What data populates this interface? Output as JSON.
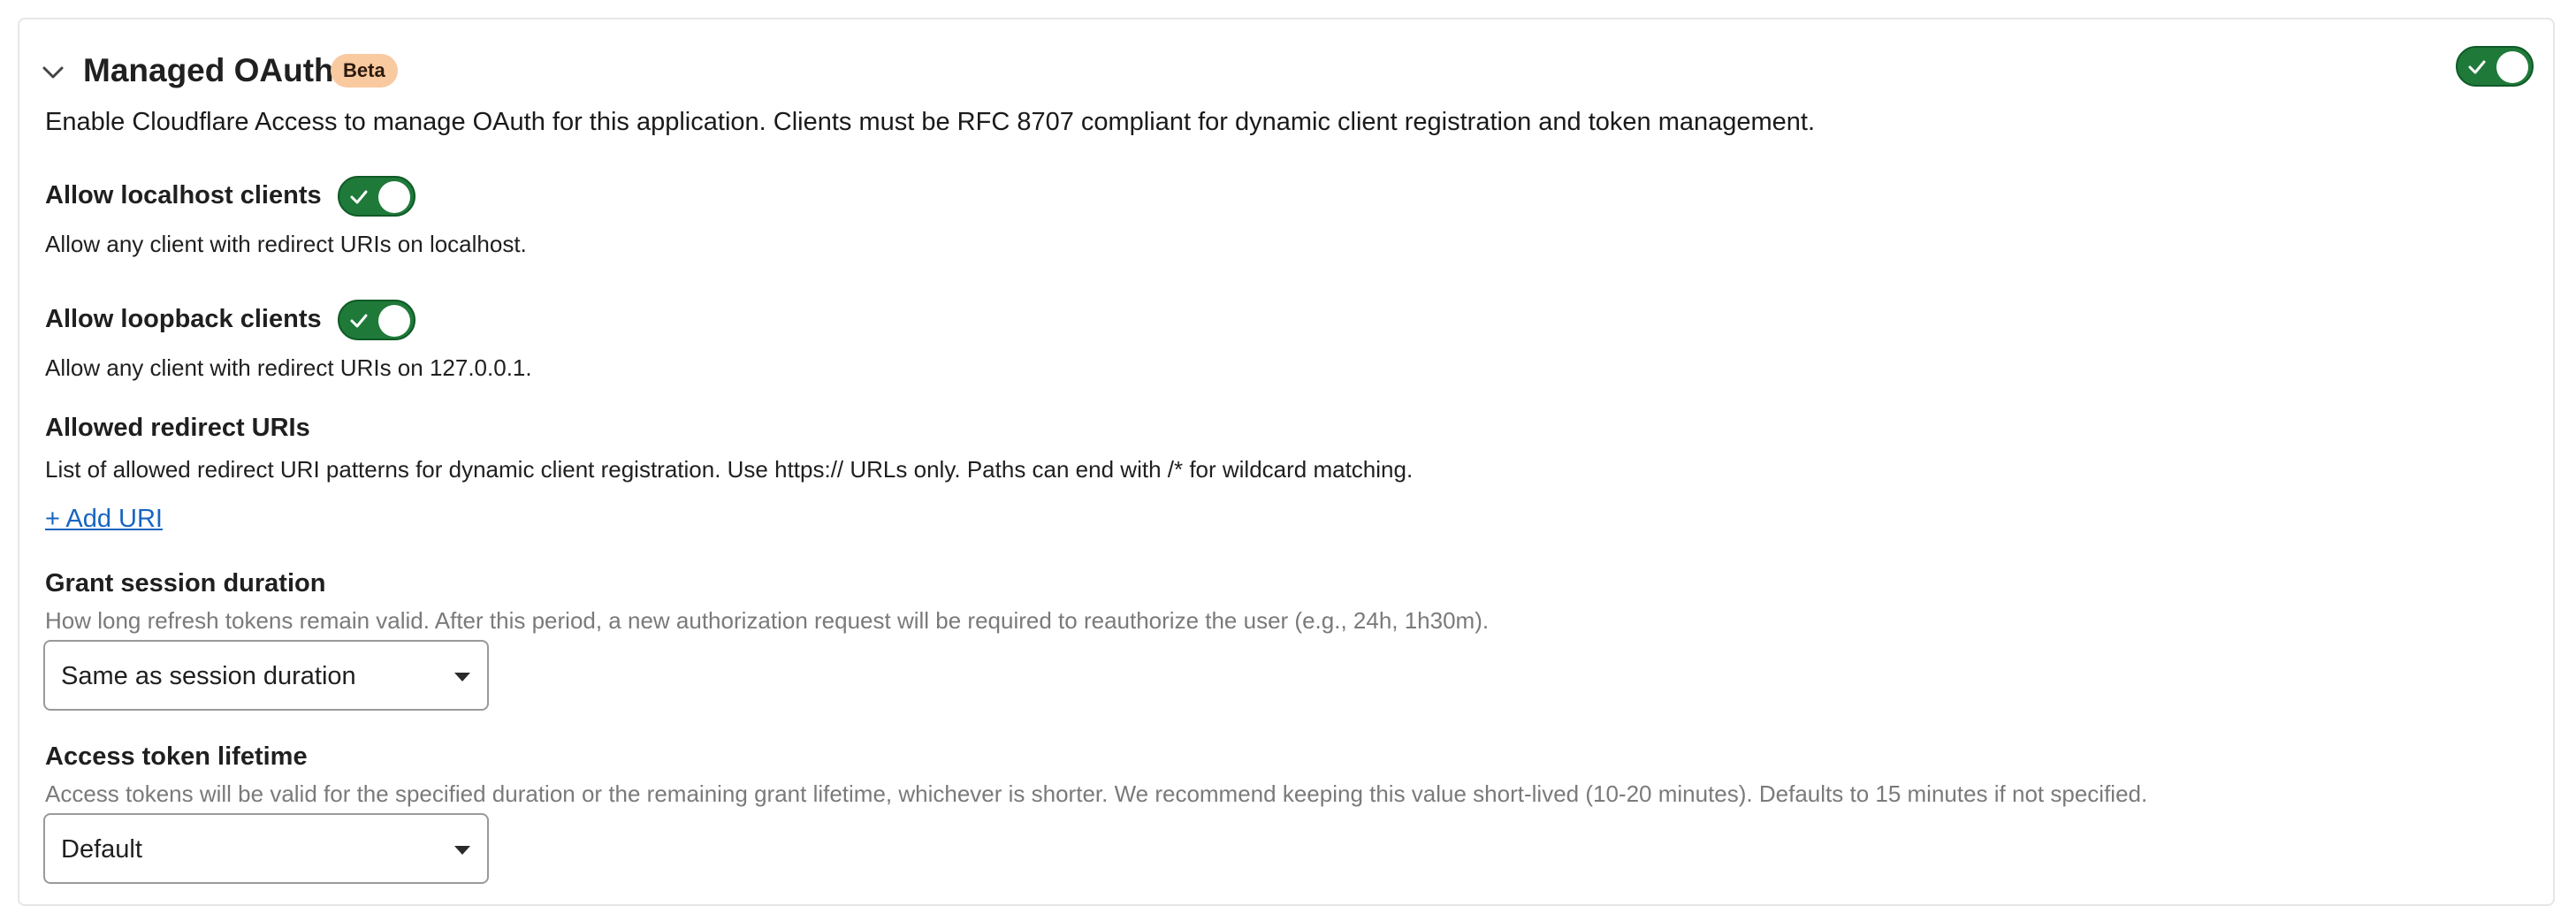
{
  "section": {
    "title": "Managed OAuth",
    "badge": "Beta",
    "description": "Enable Cloudflare Access to manage OAuth for this application. Clients must be RFC 8707 compliant for dynamic client registration and token management.",
    "enabled": true
  },
  "localhost": {
    "label": "Allow localhost clients",
    "help": "Allow any client with redirect URIs on localhost.",
    "enabled": true
  },
  "loopback": {
    "label": "Allow loopback clients",
    "help": "Allow any client with redirect URIs on 127.0.0.1.",
    "enabled": true
  },
  "redirect_uris": {
    "label": "Allowed redirect URIs",
    "help": "List of allowed redirect URI patterns for dynamic client registration. Use https:// URLs only. Paths can end with /* for wildcard matching.",
    "add_link": "+ Add URI"
  },
  "grant_session": {
    "label": "Grant session duration",
    "help": "How long refresh tokens remain valid. After this period, a new authorization request will be required to reauthorize the user (e.g., 24h, 1h30m).",
    "value": "Same as session duration"
  },
  "access_token": {
    "label": "Access token lifetime",
    "help": "Access tokens will be valid for the specified duration or the remaining grant lifetime, whichever is shorter. We recommend keeping this value short-lived (10-20 minutes). Defaults to 15 minutes if not specified.",
    "value": "Default"
  },
  "colors": {
    "toggle_on": "#1f7a3a",
    "link": "#1765c0",
    "badge_bg": "#f9c9a0"
  },
  "icons": {
    "collapse": "chevron-down-icon",
    "toggle_check": "check-icon",
    "select_caret": "caret-down-icon"
  }
}
